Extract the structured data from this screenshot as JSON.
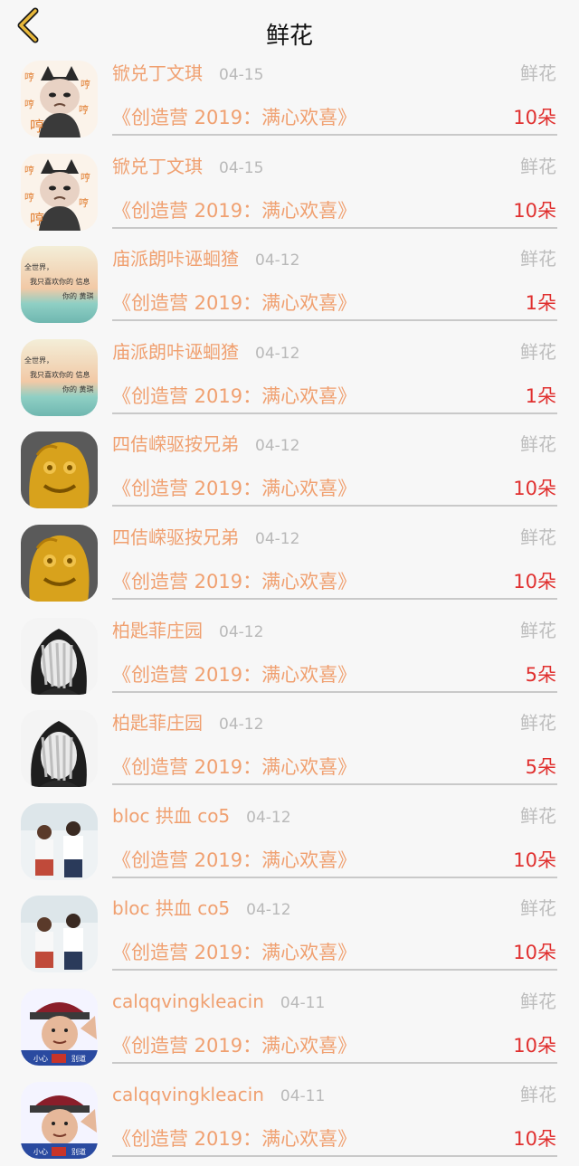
{
  "header": {
    "title": "鲜花",
    "back_icon": "chevron-left-icon",
    "accent": "#e8b83a"
  },
  "colors": {
    "name": "#f0a070",
    "count": "#e0302f",
    "tag": "#bdbdbd",
    "date": "#b9b9b9"
  },
  "items": [
    {
      "avatar": "cat-hat-sticker",
      "name": "锨兑丁文琪",
      "date": "04-15",
      "tag": "鲜花",
      "event": "《创造营 2019：满心欢喜》",
      "count": "10朵"
    },
    {
      "avatar": "cat-hat-sticker",
      "name": "锨兑丁文琪",
      "date": "04-15",
      "tag": "鲜花",
      "event": "《创造营 2019：满心欢喜》",
      "count": "10朵"
    },
    {
      "avatar": "sunset-text",
      "name": "庙派朗咔诬蛔猹",
      "date": "04-12",
      "tag": "鲜花",
      "event": "《创造营 2019：满心欢喜》",
      "count": "1朵"
    },
    {
      "avatar": "sunset-text",
      "name": "庙派朗咔诬蛔猹",
      "date": "04-12",
      "tag": "鲜花",
      "event": "《创造营 2019：满心欢喜》",
      "count": "1朵"
    },
    {
      "avatar": "gold-statue",
      "name": "四佶嵘驱按兄弟",
      "date": "04-12",
      "tag": "鲜花",
      "event": "《创造营 2019：满心欢喜》",
      "count": "10朵"
    },
    {
      "avatar": "gold-statue",
      "name": "四佶嵘驱按兄弟",
      "date": "04-12",
      "tag": "鲜花",
      "event": "《创造营 2019：满心欢喜》",
      "count": "10朵"
    },
    {
      "avatar": "face-hands",
      "name": "柏匙菲庄园",
      "date": "04-12",
      "tag": "鲜花",
      "event": "《创造营 2019：满心欢喜》",
      "count": "5朵"
    },
    {
      "avatar": "face-hands",
      "name": "柏匙菲庄园",
      "date": "04-12",
      "tag": "鲜花",
      "event": "《创造营 2019：满心欢喜》",
      "count": "5朵"
    },
    {
      "avatar": "couple-photo",
      "name": "bloc 拱血 co5",
      "date": "04-12",
      "tag": "鲜花",
      "event": "《创造营 2019：满心欢喜》",
      "count": "10朵"
    },
    {
      "avatar": "couple-photo",
      "name": "bloc 拱血 co5",
      "date": "04-12",
      "tag": "鲜花",
      "event": "《创造营 2019：满心欢喜》",
      "count": "10朵"
    },
    {
      "avatar": "qing-official",
      "name": "calqqvingkleacin",
      "date": "04-11",
      "tag": "鲜花",
      "event": "《创造营 2019：满心欢喜》",
      "count": "10朵"
    },
    {
      "avatar": "qing-official",
      "name": "calqqvingkleacin",
      "date": "04-11",
      "tag": "鲜花",
      "event": "《创造营 2019：满心欢喜》",
      "count": "10朵"
    }
  ]
}
